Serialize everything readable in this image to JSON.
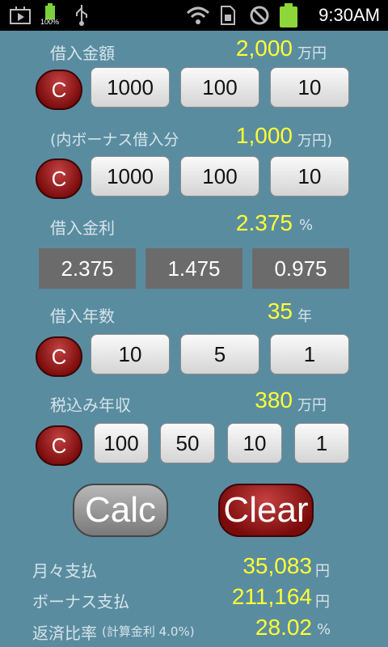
{
  "status": {
    "battery_percent": "100%",
    "time": "9:30AM"
  },
  "loan_amount": {
    "label": "借入金額",
    "value": "2,000",
    "unit": "万円",
    "buttons": [
      "C",
      "1000",
      "100",
      "10"
    ]
  },
  "bonus_loan": {
    "label": "(内ボーナス借入分",
    "value": "1,000",
    "unit": "万円)",
    "buttons": [
      "C",
      "1000",
      "100",
      "10"
    ]
  },
  "interest": {
    "label": "借入金利",
    "value": "2.375",
    "unit": "%",
    "presets": [
      "2.375",
      "1.475",
      "0.975"
    ]
  },
  "years": {
    "label": "借入年数",
    "value": "35",
    "unit": "年",
    "buttons": [
      "C",
      "10",
      "5",
      "1"
    ]
  },
  "income": {
    "label": "税込み年収",
    "value": "380",
    "unit": "万円",
    "buttons": [
      "C",
      "100",
      "50",
      "10",
      "1"
    ]
  },
  "actions": {
    "calc": "Calc",
    "clear": "Clear"
  },
  "results": {
    "monthly": {
      "label": "月々支払",
      "value": "35,083",
      "unit": "円"
    },
    "bonus": {
      "label": "ボーナス支払",
      "value": "211,164",
      "unit": "円"
    },
    "ratio": {
      "label": "返済比率",
      "sublabel": "(計算金利 4.0%)",
      "value": "28.02",
      "unit": "%"
    }
  }
}
